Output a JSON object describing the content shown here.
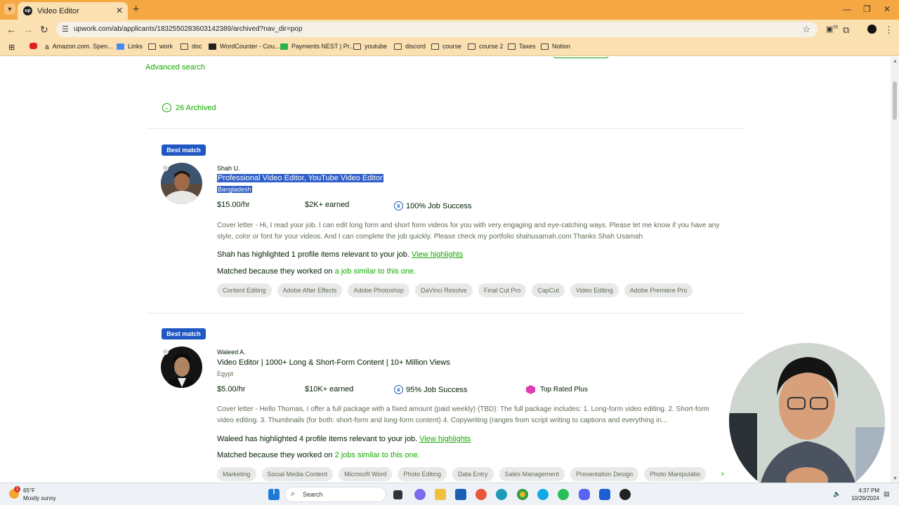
{
  "browser": {
    "tab_title": "Video Editor",
    "tab_favicon": "up",
    "url": "upwork.com/ab/applicants/1832550283603142389/archived?nav_dir=pop",
    "ext_badge": "55",
    "bookmarks": [
      "Amazon.com. Spen...",
      "Links",
      "work",
      "doc",
      "WordCounter - Cou...",
      "Payments NEST | Pr...",
      "youtube",
      "discord",
      "course",
      "course 2",
      "Taxes",
      "Notion"
    ]
  },
  "page": {
    "advanced_search": "Advanced search",
    "archived_label": "26 Archived",
    "colors": {
      "green": "#14a800",
      "badge_blue": "#1f57c3",
      "selection": "#2f5fc9"
    }
  },
  "applicants": [
    {
      "badge": "Best match",
      "name": "Shah U.",
      "title": "Professional Video Editor, YouTube Video Editor",
      "country": "Bangladesh",
      "rate": "$15.00/hr",
      "earned": "$2K+ earned",
      "job_success": "100% Job Success",
      "cover": "Cover letter - Hi, I read your job. I can edit long form and short form videos for you with very engaging and eye-catching ways. Please let me know if you have any style, color or font for your videos. And I can complete the job quickly. Please check my portfolio shahusamah.com Thanks Shah Usamah",
      "highlight_text": "Shah has highlighted 1 profile items relevant to your job.",
      "highlight_link": "View highlights",
      "matched_text": "Matched because they worked on",
      "matched_link": "a job similar to this one.",
      "skills": [
        "Content Editing",
        "Adobe After Effects",
        "Adobe Photoshop",
        "DaVinci Resolve",
        "Final Cut Pro",
        "CapCut",
        "Video Editing",
        "Adobe Premiere Pro"
      ]
    },
    {
      "badge": "Best match",
      "name": "Waleed A.",
      "title": "Video Editor | 1000+ Long & Short-Form Content | 10+ Million Views",
      "country": "Egypt",
      "rate": "$5.00/hr",
      "earned": "$10K+ earned",
      "job_success": "95% Job Success",
      "top_rated": "Top Rated Plus",
      "cover": "Cover letter - Hello Thomas, I offer a full package with a fixed amount (paid weekly) (TBD): The full package includes: 1. Long-form video editing. 2. Short-form video editing. 3. Thumbnails (for both: short-form and long-form content) 4. Copywriting (ranges from script writing to captions and everything in...",
      "highlight_text": "Waleed has highlighted 4 profile items relevant to your job.",
      "highlight_link": "View highlights",
      "matched_text": "Matched because they worked on",
      "matched_link": "2 jobs similar to this one.",
      "skills": [
        "Marketing",
        "Social Media Content",
        "Microsoft Word",
        "Photo Editing",
        "Data Entry",
        "Sales Management",
        "Presentation Design",
        "Photo Manipulatio"
      ]
    }
  ],
  "taskbar": {
    "weather_temp": "65°F",
    "weather_desc": "Mostly sunny",
    "weather_badge": "1",
    "search_label": "Search",
    "time": "4:37 PM",
    "date": "10/29/2024"
  }
}
